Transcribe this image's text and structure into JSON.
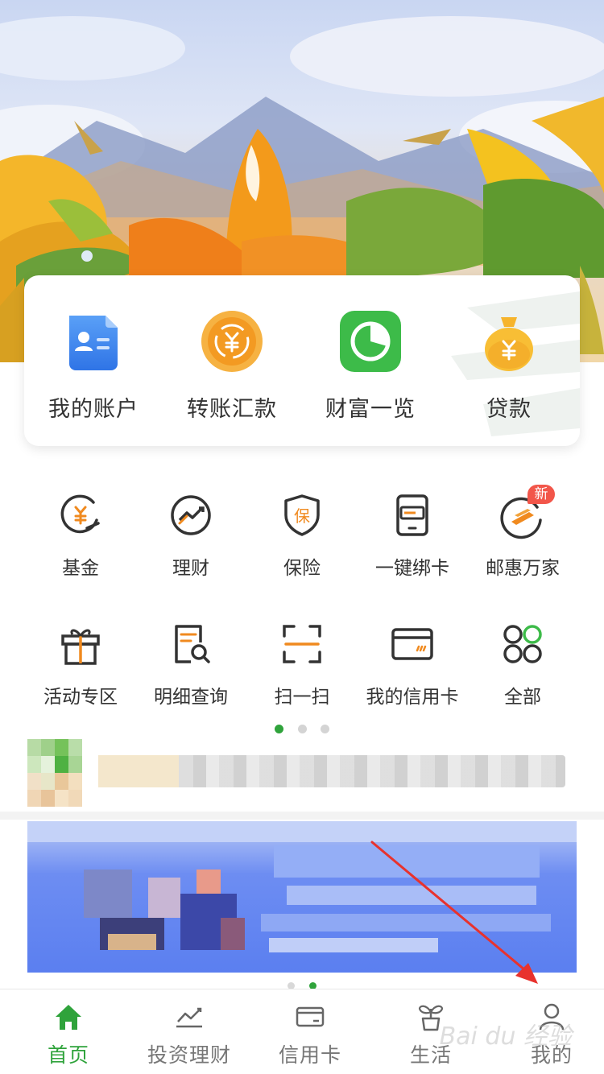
{
  "quick_actions": [
    {
      "label": "我的账户",
      "icon": "account-card-icon",
      "color": "#3e86f0"
    },
    {
      "label": "转账汇款",
      "icon": "transfer-yuan-icon",
      "color": "#f2a52b"
    },
    {
      "label": "财富一览",
      "icon": "wealth-pie-icon",
      "color": "#3cbf4b"
    },
    {
      "label": "贷款",
      "icon": "loan-bag-icon",
      "color": "#f2b12b"
    }
  ],
  "features_row1": [
    {
      "label": "基金",
      "icon": "fund-icon"
    },
    {
      "label": "理财",
      "icon": "finance-chart-icon"
    },
    {
      "label": "保险",
      "icon": "insurance-shield-icon",
      "icon_text": "保"
    },
    {
      "label": "一键绑卡",
      "icon": "bind-card-icon"
    },
    {
      "label": "邮惠万家",
      "icon": "youhui-logo-icon",
      "badge": "新"
    }
  ],
  "features_row2": [
    {
      "label": "活动专区",
      "icon": "gift-icon"
    },
    {
      "label": "明细查询",
      "icon": "detail-search-icon"
    },
    {
      "label": "扫一扫",
      "icon": "scan-icon"
    },
    {
      "label": "我的信用卡",
      "icon": "credit-card-icon"
    },
    {
      "label": "全部",
      "icon": "all-grid-icon"
    }
  ],
  "pager": {
    "count": 3,
    "active": 0
  },
  "promo_pager": {
    "count": 2,
    "active": 1
  },
  "tabbar": [
    {
      "label": "首页",
      "icon": "home-icon",
      "active": true
    },
    {
      "label": "投资理财",
      "icon": "investment-icon",
      "active": false
    },
    {
      "label": "信用卡",
      "icon": "credit-card-tab-icon",
      "active": false
    },
    {
      "label": "生活",
      "icon": "life-sprout-icon",
      "active": false
    },
    {
      "label": "我的",
      "icon": "profile-icon",
      "active": false
    }
  ],
  "colors": {
    "accent_green": "#2fa33b",
    "annotation_red": "#e8322d",
    "icon_orange": "#f08a1f"
  },
  "watermark": "Bai du 经验"
}
